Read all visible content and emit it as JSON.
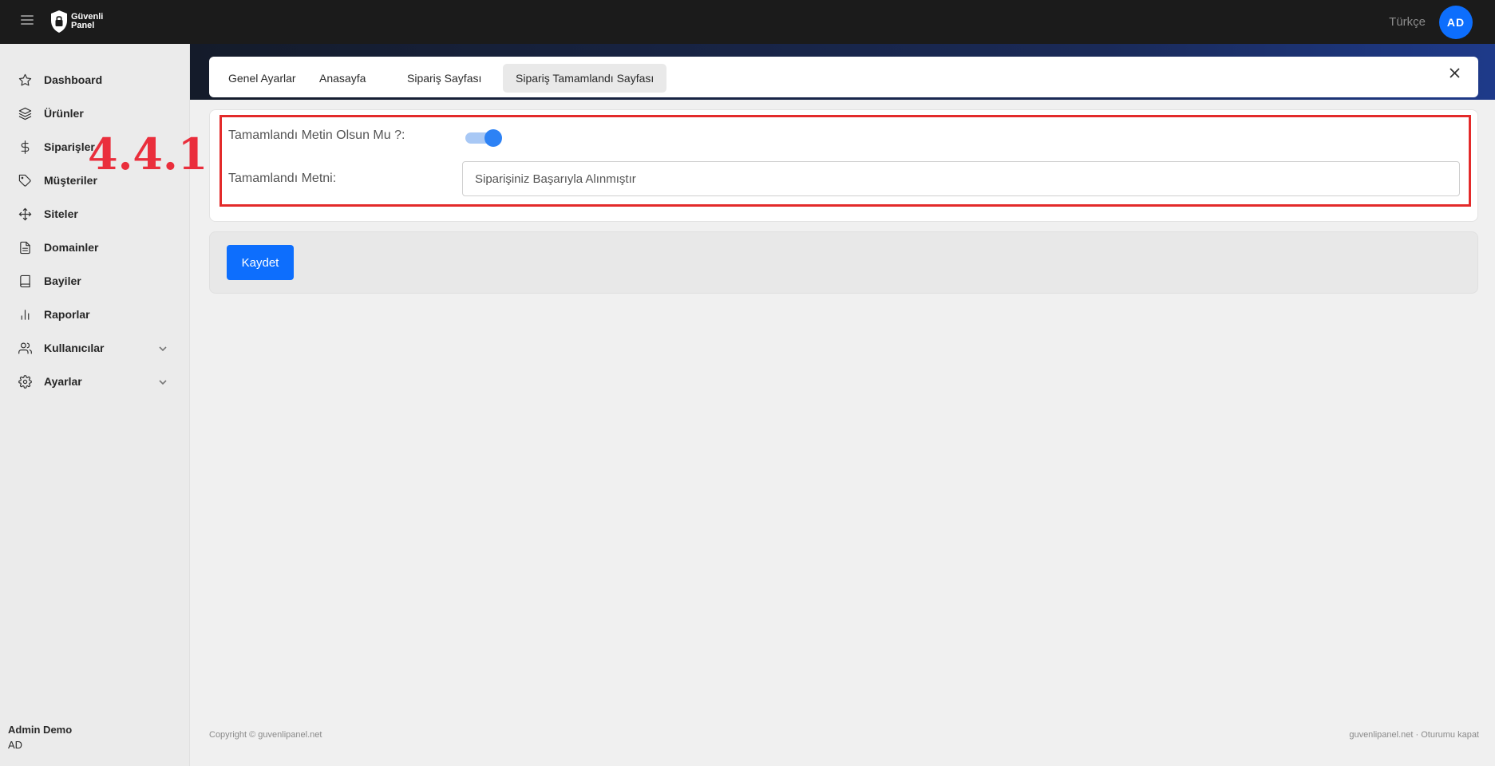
{
  "topbar": {
    "logo_line1": "Güvenli",
    "logo_line2": "Panel",
    "language": "Türkçe",
    "avatar_initials": "AD"
  },
  "sidebar": {
    "items": [
      {
        "label": "Dashboard",
        "icon": "star-icon"
      },
      {
        "label": "Ürünler",
        "icon": "layers-icon"
      },
      {
        "label": "Siparişler",
        "icon": "dollar-icon"
      },
      {
        "label": "Müşteriler",
        "icon": "tag-icon"
      },
      {
        "label": "Siteler",
        "icon": "move-icon"
      },
      {
        "label": "Domainler",
        "icon": "file-icon"
      },
      {
        "label": "Bayiler",
        "icon": "book-icon"
      },
      {
        "label": "Raporlar",
        "icon": "bar-chart-icon"
      },
      {
        "label": "Kullanıcılar",
        "icon": "users-icon"
      },
      {
        "label": "Ayarlar",
        "icon": "gear-icon"
      }
    ],
    "user_name": "Admin Demo",
    "user_initials": "AD"
  },
  "tabs": [
    {
      "label": "Genel Ayarlar"
    },
    {
      "label": "Anasayfa"
    },
    {
      "label": "Sipariş Sayfası"
    },
    {
      "label": "Sipariş Tamamlandı Sayfası",
      "active": true
    }
  ],
  "form": {
    "toggle_label": "Tamamlandı Metin Olsun Mu ?:",
    "toggle_on": true,
    "text_label": "Tamamlandı Metni:",
    "text_value": "Siparişiniz Başarıyla Alınmıştır"
  },
  "annotation": "4.4.1",
  "save_label": "Kaydet",
  "footer": {
    "copyright": "Copyright © guvenlipanel.net",
    "site": "guvenlipanel.net",
    "separator": " · ",
    "logout": "Oturumu kapat"
  },
  "colors": {
    "accent": "#0d6efd",
    "highlight": "#e32a2a",
    "topbar": "#1b1b1b"
  }
}
